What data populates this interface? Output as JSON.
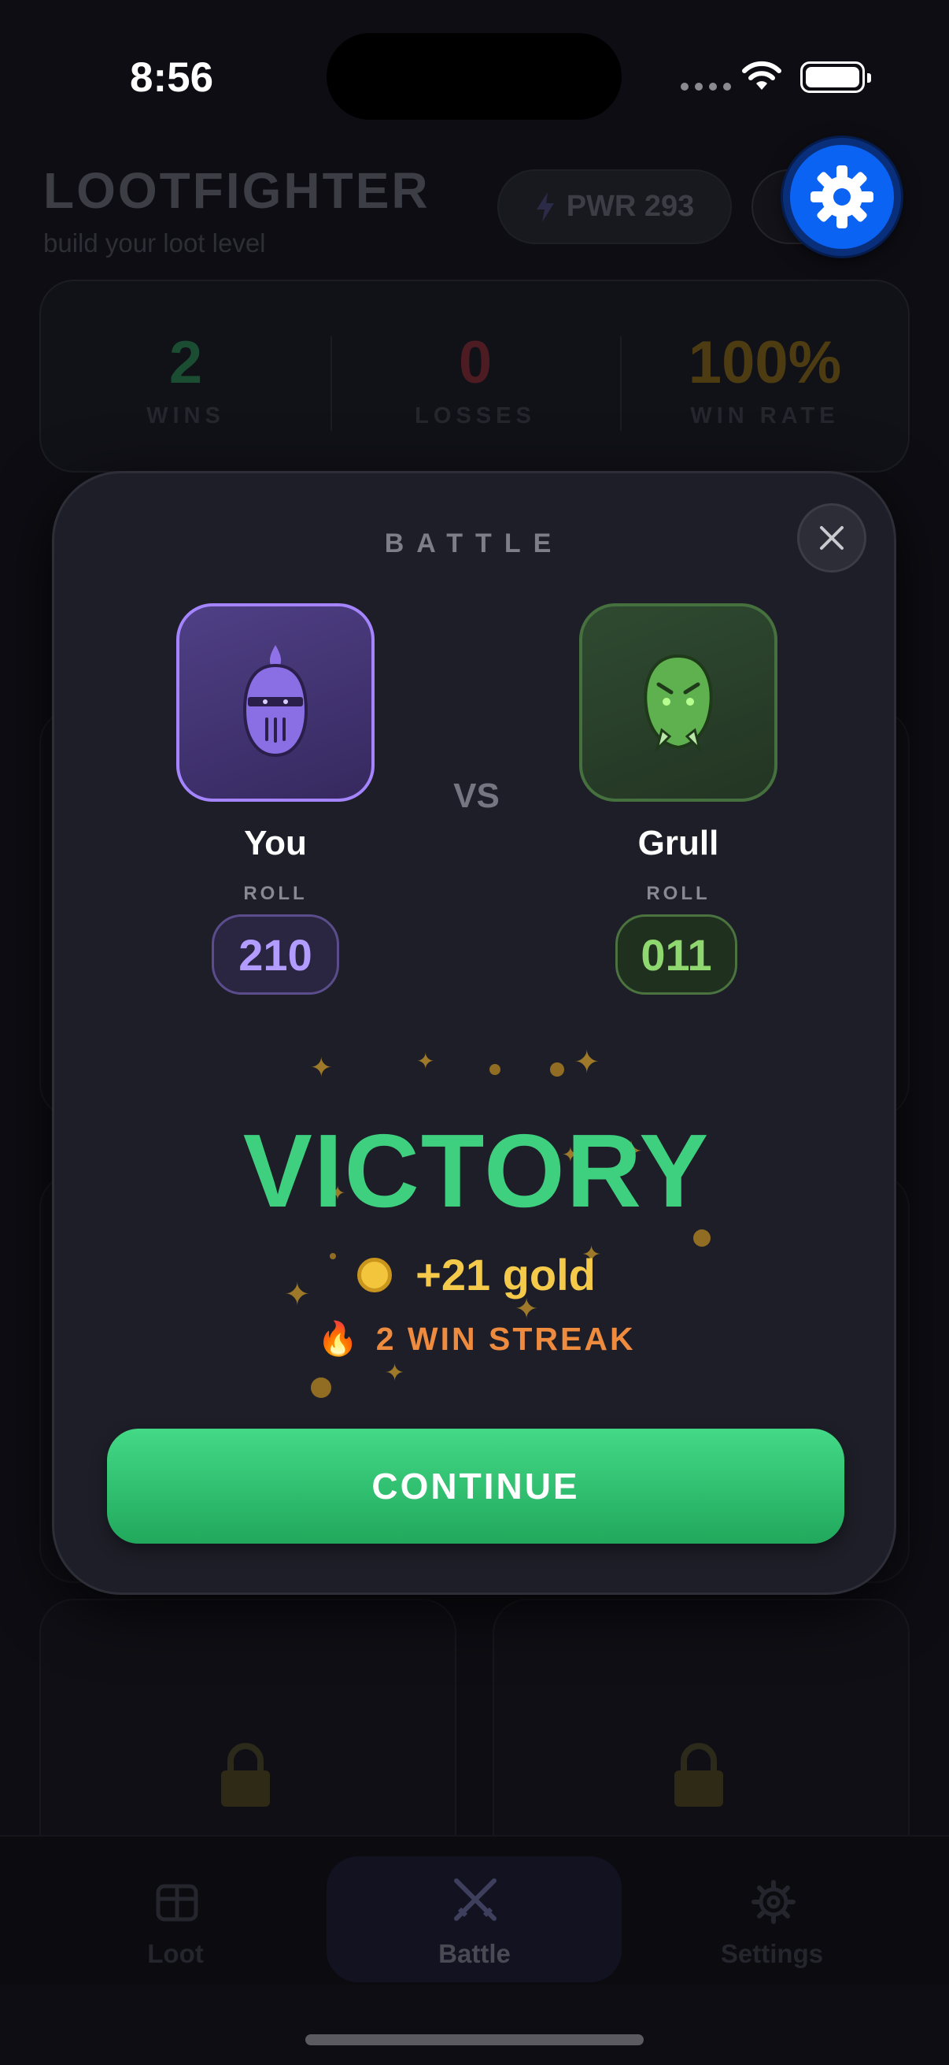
{
  "status_bar": {
    "time": "8:56"
  },
  "header": {
    "app_title": "LOOTFIGHTER",
    "subtitle": "build your loot level",
    "power_label": "PWR 293"
  },
  "stats": [
    {
      "value": "2",
      "label": "WINS",
      "color": "#1b4d33"
    },
    {
      "value": "0",
      "label": "LOSSES",
      "color": "#4d1b22"
    },
    {
      "value": "100%",
      "label": "WIN RATE",
      "color": "#4d3c12"
    }
  ],
  "tabbar": {
    "tabs": [
      {
        "label": "Loot",
        "icon": "box-icon",
        "active": false
      },
      {
        "label": "Battle",
        "icon": "crossed-swords-icon",
        "active": true
      },
      {
        "label": "Settings",
        "icon": "gear-icon",
        "active": false
      }
    ]
  },
  "modal": {
    "title": "BATTLE",
    "vs_label": "VS",
    "player": {
      "name": "You",
      "roll_label": "ROLL",
      "roll": "210",
      "icon": "knight-helmet-icon"
    },
    "enemy": {
      "name": "Grull",
      "roll_label": "ROLL",
      "roll": "011",
      "icon": "goblin-head-icon"
    },
    "result": "VICTORY",
    "reward": "+21 gold",
    "streak_emoji": "🔥",
    "streak": "2 WIN STREAK",
    "continue_label": "CONTINUE"
  },
  "colors": {
    "accent_purple": "#a585ff",
    "accent_green": "#3fd07f",
    "gold": "#f5c94a",
    "streak_orange": "#ee8b3f",
    "fab_blue": "#0a63f2"
  }
}
